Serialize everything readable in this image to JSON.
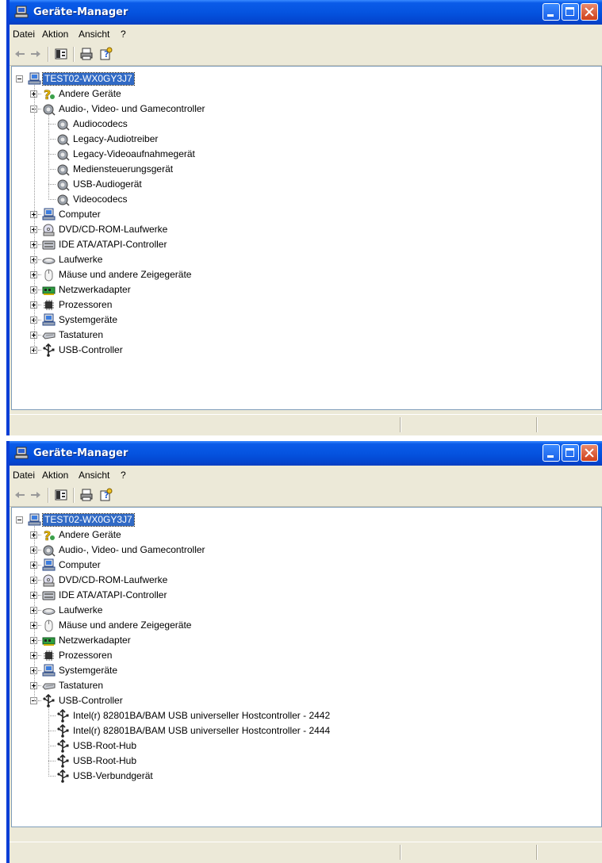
{
  "window_title": "Geräte-Manager",
  "menu": [
    {
      "key": "datei",
      "label": "Datei"
    },
    {
      "key": "aktion",
      "label": "Aktion"
    },
    {
      "key": "ansicht",
      "label": "Ansicht"
    },
    {
      "key": "hilfe",
      "label": "?"
    }
  ],
  "toolbar_icons": [
    "back-arrow-icon",
    "forward-arrow-icon",
    "properties-icon",
    "print-icon",
    "help-icon"
  ],
  "colors": {
    "titlebar": "#0554e0",
    "selection": "#316ac5",
    "window_border": "#0a3fd6",
    "frame": "#ece9d8"
  },
  "windows": [
    {
      "id": "w1",
      "root": "TEST02-WX0GY3J7",
      "tree": [
        {
          "label": "Andere Geräte",
          "icon": "unknown-device-icon",
          "expanded": false,
          "children": []
        },
        {
          "label": "Audio-, Video- und Gamecontroller",
          "icon": "speaker-icon",
          "expanded": true,
          "children": [
            {
              "label": "Audiocodecs",
              "icon": "speaker-icon"
            },
            {
              "label": "Legacy-Audiotreiber",
              "icon": "speaker-icon"
            },
            {
              "label": "Legacy-Videoaufnahmegerät",
              "icon": "speaker-icon"
            },
            {
              "label": "Mediensteuerungsgerät",
              "icon": "speaker-icon"
            },
            {
              "label": "USB-Audiogerät",
              "icon": "speaker-icon"
            },
            {
              "label": "Videocodecs",
              "icon": "speaker-icon"
            }
          ]
        },
        {
          "label": "Computer",
          "icon": "computer-icon",
          "expanded": false,
          "children": []
        },
        {
          "label": "DVD/CD-ROM-Laufwerke",
          "icon": "cdrom-icon",
          "expanded": false,
          "children": []
        },
        {
          "label": "IDE ATA/ATAPI-Controller",
          "icon": "ide-controller-icon",
          "expanded": false,
          "children": []
        },
        {
          "label": "Laufwerke",
          "icon": "disk-drive-icon",
          "expanded": false,
          "children": []
        },
        {
          "label": "Mäuse und andere Zeigegeräte",
          "icon": "mouse-icon",
          "expanded": false,
          "children": []
        },
        {
          "label": "Netzwerkadapter",
          "icon": "network-adapter-icon",
          "expanded": false,
          "children": []
        },
        {
          "label": "Prozessoren",
          "icon": "processor-icon",
          "expanded": false,
          "children": []
        },
        {
          "label": "Systemgeräte",
          "icon": "system-device-icon",
          "expanded": false,
          "children": []
        },
        {
          "label": "Tastaturen",
          "icon": "keyboard-icon",
          "expanded": false,
          "children": []
        },
        {
          "label": "USB-Controller",
          "icon": "usb-icon",
          "expanded": false,
          "children": []
        }
      ]
    },
    {
      "id": "w2",
      "root": "TEST02-WX0GY3J7",
      "tree": [
        {
          "label": "Andere Geräte",
          "icon": "unknown-device-icon",
          "expanded": false,
          "children": []
        },
        {
          "label": "Audio-, Video- und Gamecontroller",
          "icon": "speaker-icon",
          "expanded": false,
          "children": []
        },
        {
          "label": "Computer",
          "icon": "computer-icon",
          "expanded": false,
          "children": []
        },
        {
          "label": "DVD/CD-ROM-Laufwerke",
          "icon": "cdrom-icon",
          "expanded": false,
          "children": []
        },
        {
          "label": "IDE ATA/ATAPI-Controller",
          "icon": "ide-controller-icon",
          "expanded": false,
          "children": []
        },
        {
          "label": "Laufwerke",
          "icon": "disk-drive-icon",
          "expanded": false,
          "children": []
        },
        {
          "label": "Mäuse und andere Zeigegeräte",
          "icon": "mouse-icon",
          "expanded": false,
          "children": []
        },
        {
          "label": "Netzwerkadapter",
          "icon": "network-adapter-icon",
          "expanded": false,
          "children": []
        },
        {
          "label": "Prozessoren",
          "icon": "processor-icon",
          "expanded": false,
          "children": []
        },
        {
          "label": "Systemgeräte",
          "icon": "system-device-icon",
          "expanded": false,
          "children": []
        },
        {
          "label": "Tastaturen",
          "icon": "keyboard-icon",
          "expanded": false,
          "children": []
        },
        {
          "label": "USB-Controller",
          "icon": "usb-icon",
          "expanded": true,
          "children": [
            {
              "label": "Intel(r) 82801BA/BAM USB universeller Hostcontroller - 2442",
              "icon": "usb-icon"
            },
            {
              "label": "Intel(r) 82801BA/BAM USB universeller Hostcontroller - 2444",
              "icon": "usb-icon"
            },
            {
              "label": "USB-Root-Hub",
              "icon": "usb-icon"
            },
            {
              "label": "USB-Root-Hub",
              "icon": "usb-icon"
            },
            {
              "label": "USB-Verbundgerät",
              "icon": "usb-icon"
            }
          ]
        }
      ]
    }
  ]
}
